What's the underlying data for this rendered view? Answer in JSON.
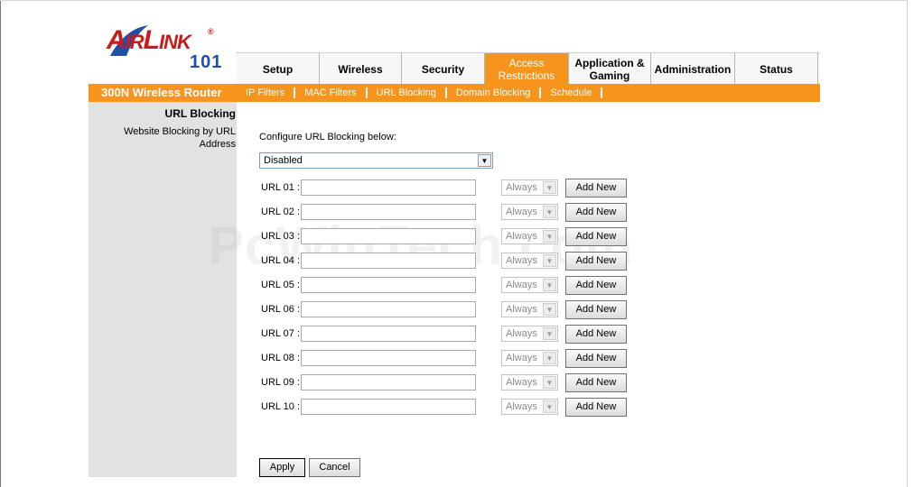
{
  "logo": {
    "word_a": "A",
    "word_ir": "IR",
    "word_l": "L",
    "word_ink": "INK",
    "reg": "®",
    "number": "101"
  },
  "tabs": [
    {
      "label": "Setup",
      "width": 92
    },
    {
      "label": "Wireless",
      "width": 91
    },
    {
      "label": "Security",
      "width": 92
    },
    {
      "label": "Access Restrictions",
      "width": 93,
      "active": true
    },
    {
      "label": "Application & Gaming",
      "width": 91
    },
    {
      "label": "Administration",
      "width": 93
    },
    {
      "label": "Status",
      "width": 92
    }
  ],
  "router_name": "300N Wireless Router",
  "subtabs": [
    "IP Filters",
    "MAC Filters",
    "URL Blocking",
    "Domain Blocking",
    "Schedule"
  ],
  "left": {
    "title": "URL Blocking",
    "description": "Website Blocking by URL Address"
  },
  "config_label": "Configure URL Blocking below:",
  "mode_value": "Disabled",
  "dropdown_glyph": "▼",
  "rows": [
    {
      "label": "URL 01 :",
      "schedule": "Always",
      "button": "Add New"
    },
    {
      "label": "URL 02 :",
      "schedule": "Always",
      "button": "Add New"
    },
    {
      "label": "URL 03 :",
      "schedule": "Always",
      "button": "Add New"
    },
    {
      "label": "URL 04 :",
      "schedule": "Always",
      "button": "Add New"
    },
    {
      "label": "URL 05 :",
      "schedule": "Always",
      "button": "Add New"
    },
    {
      "label": "URL 06 :",
      "schedule": "Always",
      "button": "Add New"
    },
    {
      "label": "URL 07 :",
      "schedule": "Always",
      "button": "Add New"
    },
    {
      "label": "URL 08 :",
      "schedule": "Always",
      "button": "Add New"
    },
    {
      "label": "URL 09 :",
      "schedule": "Always",
      "button": "Add New"
    },
    {
      "label": "URL 10 :",
      "schedule": "Always",
      "button": "Add New"
    }
  ],
  "apply_label": "Apply",
  "cancel_label": "Cancel",
  "watermark": "PcWinTech.com",
  "colors": {
    "accent": "#f7941d",
    "brand_red": "#cc1a1a",
    "brand_blue": "#1f4fa8",
    "panel_grey": "#e2e2e2"
  }
}
